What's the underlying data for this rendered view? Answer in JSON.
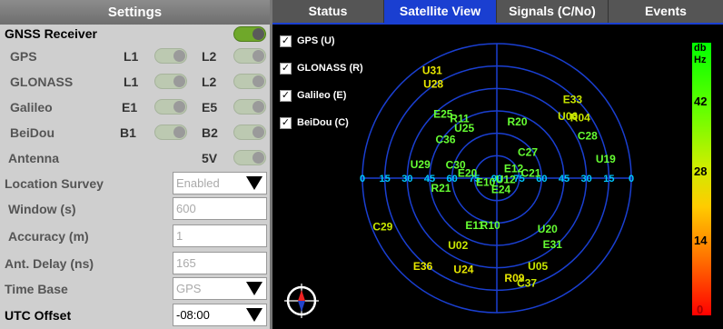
{
  "settings": {
    "title": "Settings",
    "gnss_receiver": "GNSS Receiver",
    "constellations": [
      {
        "name": "GPS",
        "band1": "L1",
        "band2": "L2"
      },
      {
        "name": "GLONASS",
        "band1": "L1",
        "band2": "L2"
      },
      {
        "name": "Galileo",
        "band1": "E1",
        "band2": "E5"
      },
      {
        "name": "BeiDou",
        "band1": "B1",
        "band2": "B2"
      }
    ],
    "antenna": {
      "label": "Antenna",
      "value": "5V"
    },
    "location_survey": {
      "label": "Location Survey",
      "value": "Enabled"
    },
    "window": {
      "label": "Window (s)",
      "value": "600"
    },
    "accuracy": {
      "label": "Accuracy (m)",
      "value": "1"
    },
    "ant_delay": {
      "label": "Ant. Delay (ns)",
      "value": "165"
    },
    "time_base": {
      "label": "Time Base",
      "value": "GPS"
    },
    "utc_offset": {
      "label": "UTC Offset",
      "value": "-08:00"
    }
  },
  "tabs": [
    "Status",
    "Satellite View",
    "Signals (C/No)",
    "Events"
  ],
  "active_tab": "Satellite View",
  "filters": [
    {
      "label": "GPS (U)",
      "checked": true
    },
    {
      "label": "GLONASS (R)",
      "checked": true
    },
    {
      "label": "Galileo (E)",
      "checked": true
    },
    {
      "label": "BeiDou (C)",
      "checked": true
    }
  ],
  "sky_plot": {
    "elevation_ticks_left": [
      "0",
      "15",
      "30",
      "45",
      "60",
      "75"
    ],
    "elevation_ticks_right": [
      "75",
      "60",
      "45",
      "30",
      "15",
      "0"
    ],
    "center_label": "90",
    "satellites": [
      {
        "id": "U31",
        "az": -31,
        "el": 6,
        "color": "#e6e600"
      },
      {
        "id": "U28",
        "az": -34,
        "el": 14,
        "color": "#e6e600"
      },
      {
        "id": "E33",
        "az": 44,
        "el": 17,
        "color": "#c8e600"
      },
      {
        "id": "U06",
        "az": 49,
        "el": 27,
        "color": "#c8e600"
      },
      {
        "id": "R04",
        "az": 54,
        "el": 21,
        "color": "#c8e600"
      },
      {
        "id": "C28",
        "az": 65,
        "el": 23,
        "color": "#66ff33"
      },
      {
        "id": "U19",
        "az": 80,
        "el": 16,
        "color": "#66ff33"
      },
      {
        "id": "E25",
        "az": -40,
        "el": 34,
        "color": "#66ff33"
      },
      {
        "id": "R11",
        "az": -32,
        "el": 43,
        "color": "#66ff33"
      },
      {
        "id": "U25",
        "az": -33,
        "el": 50,
        "color": "#66ff33"
      },
      {
        "id": "R20",
        "az": 20,
        "el": 50,
        "color": "#66ff33"
      },
      {
        "id": "C27",
        "az": 50,
        "el": 63,
        "color": "#66ff33"
      },
      {
        "id": "C36",
        "az": -53,
        "el": 47,
        "color": "#66ff33"
      },
      {
        "id": "E12",
        "az": 60,
        "el": 77,
        "color": "#66ff33"
      },
      {
        "id": "C21",
        "az": 82,
        "el": 67,
        "color": "#66ff33"
      },
      {
        "id": "U29",
        "az": -80,
        "el": 38,
        "color": "#66ff33"
      },
      {
        "id": "C30",
        "az": -72,
        "el": 61,
        "color": "#66ff33"
      },
      {
        "id": "E20",
        "az": -80,
        "el": 70,
        "color": "#66ff33"
      },
      {
        "id": "R21",
        "az": -100,
        "el": 52,
        "color": "#66ff33"
      },
      {
        "id": "U12",
        "az": 100,
        "el": 84,
        "color": "#66ff33"
      },
      {
        "id": "E10",
        "az": -110,
        "el": 82,
        "color": "#66ff33"
      },
      {
        "id": "E24",
        "az": 160,
        "el": 82,
        "color": "#66ff33"
      },
      {
        "id": "C29",
        "az": -113,
        "el": 7,
        "color": "#c8e600"
      },
      {
        "id": "E11",
        "az": -155,
        "el": 55,
        "color": "#66ff33"
      },
      {
        "id": "R10",
        "az": -172,
        "el": 58,
        "color": "#66ff33"
      },
      {
        "id": "U20",
        "az": 135,
        "el": 42,
        "color": "#66ff33"
      },
      {
        "id": "U02",
        "az": -150,
        "el": 38,
        "color": "#c8e600"
      },
      {
        "id": "E31",
        "az": 140,
        "el": 32,
        "color": "#66ff33"
      },
      {
        "id": "E36",
        "az": -140,
        "el": 13,
        "color": "#e6e600"
      },
      {
        "id": "U24",
        "az": -160,
        "el": 25,
        "color": "#e6e600"
      },
      {
        "id": "U05",
        "az": 155,
        "el": 25,
        "color": "#c8e600"
      },
      {
        "id": "R09",
        "az": 170,
        "el": 22,
        "color": "#e6e600"
      },
      {
        "id": "C37",
        "az": 164,
        "el": 17,
        "color": "#c8e600"
      }
    ]
  },
  "colorbar": {
    "unit_line1": "db",
    "unit_line2": "Hz",
    "ticks": [
      "42",
      "28",
      "14",
      "0"
    ]
  },
  "colors": {
    "tab_active": "#1a3fd1",
    "toggle_on": "#6fa82a",
    "grid": "#1a3fd1",
    "tick": "#00c8ff"
  }
}
